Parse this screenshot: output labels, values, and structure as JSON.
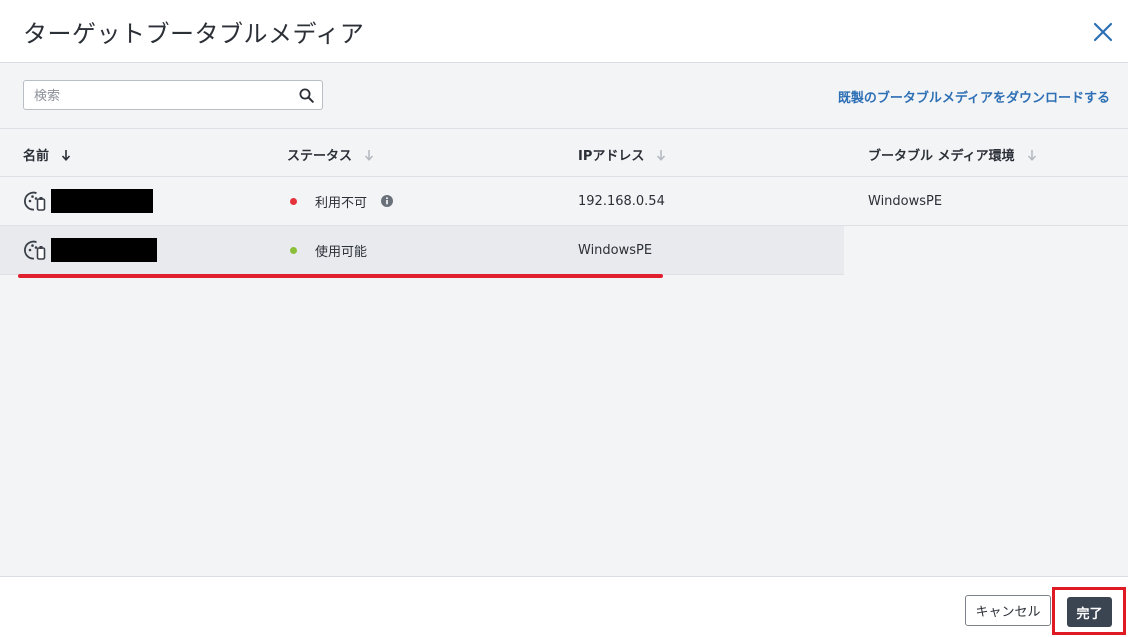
{
  "dialog": {
    "title": "ターゲットブータブルメディア"
  },
  "toolbar": {
    "search_placeholder": "検索",
    "search_value": "",
    "download_link": "既製のブータブルメディアをダウンロードする"
  },
  "table": {
    "columns": [
      "名前",
      "ステータス",
      "IPアドレス",
      "ブータブル メディア環境"
    ],
    "rows": [
      {
        "name": "",
        "status": "利用不可",
        "status_color": "#e5323b",
        "ip": "192.168.0.54",
        "environment": "WindowsPE"
      },
      {
        "name": "",
        "status": "使用可能",
        "status_color": "#8bbf3a",
        "ip": "WindowsPE",
        "environment": ""
      }
    ]
  },
  "footer": {
    "cancel_label": "キャンセル",
    "done_label": "完了"
  },
  "colors": {
    "link": "#2d6fb5",
    "highlight": "#e01a22",
    "primary_button": "#3b4451"
  }
}
